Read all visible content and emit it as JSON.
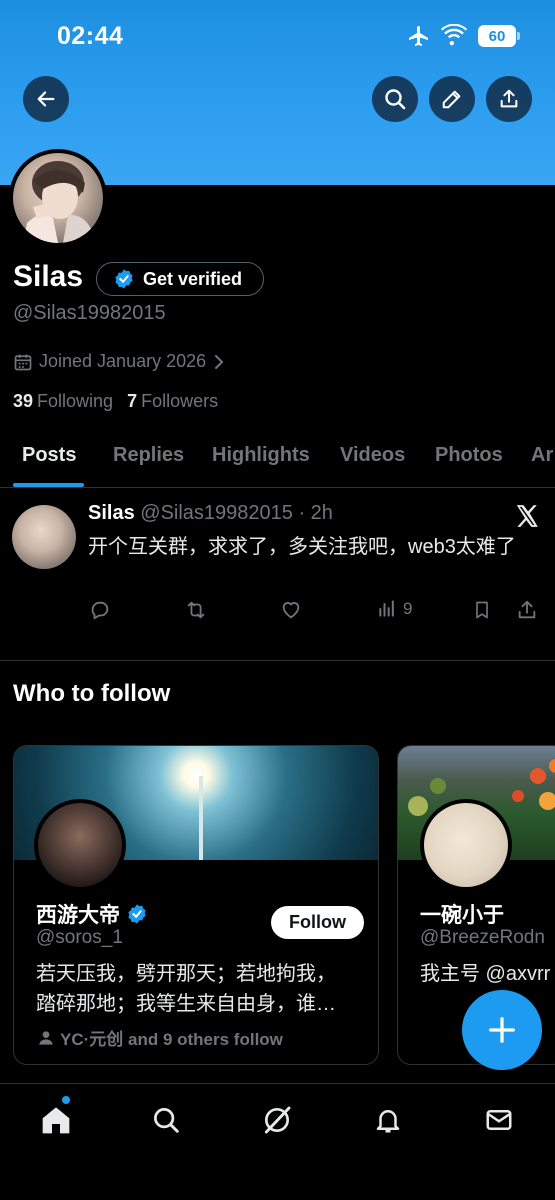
{
  "status_bar": {
    "time": "02:44",
    "battery": "60"
  },
  "header": {
    "back_icon": "arrow-left-icon",
    "search_icon": "search-icon",
    "edit_icon": "pencil-icon",
    "share_icon": "share-icon",
    "banner_color": "#2e9ef0"
  },
  "profile": {
    "name": "Silas",
    "verify_label": "Get verified",
    "handle": "@Silas19982015",
    "joined": "Joined January 2026",
    "following_count": "39",
    "following_label": "Following",
    "followers_count": "7",
    "followers_label": "Followers"
  },
  "tabs": [
    {
      "label": "Posts"
    },
    {
      "label": "Replies"
    },
    {
      "label": "Highlights"
    },
    {
      "label": "Videos"
    },
    {
      "label": "Photos"
    },
    {
      "label": "Ar"
    }
  ],
  "post": {
    "author": "Silas",
    "handle_time": "@Silas19982015 · 2h",
    "text": "开个互关群，求求了，多关注我吧，web3太难了",
    "views": "9"
  },
  "who_to_follow": {
    "title": "Who to follow",
    "cards": [
      {
        "name": "西游大帝",
        "handle": "@soros_1",
        "follow_label": "Follow",
        "bio_line1": "若天压我，劈开那天；若地拘我，",
        "bio_line2": "踏碎那地；我等生来自由身，谁…",
        "social": "YC·元创 and 9 others follow"
      },
      {
        "name": "一碗小于",
        "handle": "@BreezeRodn",
        "bio_line1": "我主号 @axvrr"
      }
    ]
  },
  "accent_color": "#1d9bf0"
}
